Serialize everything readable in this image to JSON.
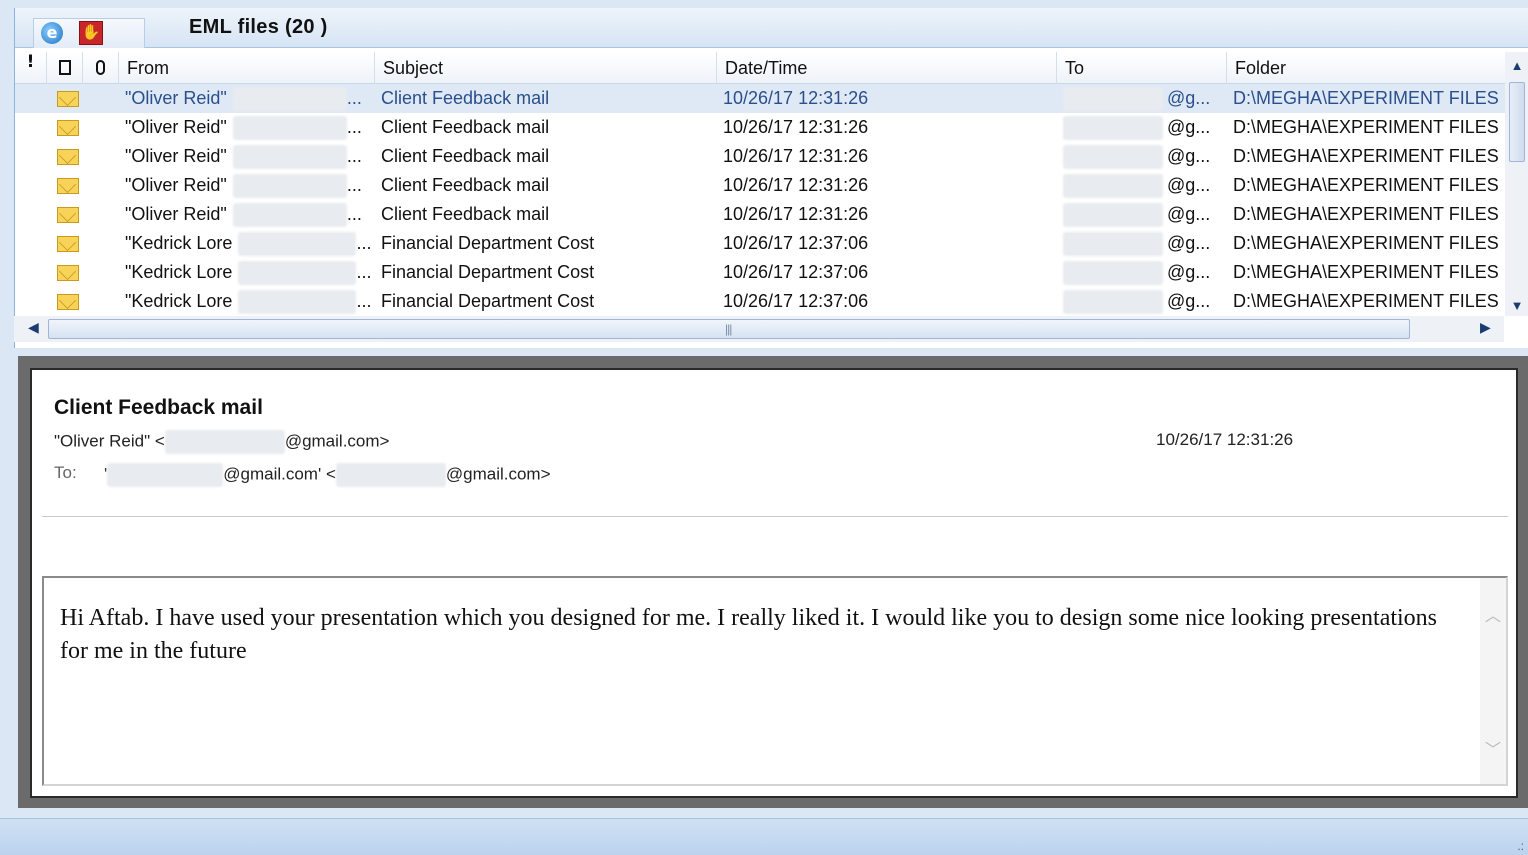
{
  "window": {
    "title": "EML files (20 )",
    "toolbar_icons": [
      "internet-explorer-icon",
      "stop-hand-icon"
    ]
  },
  "grid": {
    "columns": [
      {
        "key": "flag",
        "label": "!",
        "icon": "importance-icon"
      },
      {
        "key": "type",
        "label": "🗋",
        "icon": "document-icon"
      },
      {
        "key": "attach",
        "label": "𝟎",
        "icon": "attachment-icon"
      },
      {
        "key": "from",
        "label": "From"
      },
      {
        "key": "subject",
        "label": "Subject"
      },
      {
        "key": "date",
        "label": "Date/Time"
      },
      {
        "key": "to",
        "label": "To"
      },
      {
        "key": "folder",
        "label": "Folder"
      }
    ],
    "rows": [
      {
        "from": "\"Oliver Reid\"",
        "subject": "Client Feedback mail",
        "date": "10/26/17 12:31:26",
        "to": "@g...",
        "folder": "D:\\MEGHA\\EXPERIMENT FILES",
        "selected": true
      },
      {
        "from": "\"Oliver Reid\"",
        "subject": "Client Feedback mail",
        "date": "10/26/17 12:31:26",
        "to": "@g...",
        "folder": "D:\\MEGHA\\EXPERIMENT FILES",
        "selected": false
      },
      {
        "from": "\"Oliver Reid\"",
        "subject": "Client Feedback mail",
        "date": "10/26/17 12:31:26",
        "to": "@g...",
        "folder": "D:\\MEGHA\\EXPERIMENT FILES",
        "selected": false
      },
      {
        "from": "\"Oliver Reid\"",
        "subject": "Client Feedback mail",
        "date": "10/26/17 12:31:26",
        "to": "@g...",
        "folder": "D:\\MEGHA\\EXPERIMENT FILES",
        "selected": false
      },
      {
        "from": "\"Oliver Reid\"",
        "subject": "Client Feedback mail",
        "date": "10/26/17 12:31:26",
        "to": "@g...",
        "folder": "D:\\MEGHA\\EXPERIMENT FILES",
        "selected": false
      },
      {
        "from": "\"Kedrick Lore",
        "subject": "Financial Department Cost",
        "date": "10/26/17 12:37:06",
        "to": "@g...",
        "folder": "D:\\MEGHA\\EXPERIMENT FILES",
        "selected": false
      },
      {
        "from": "\"Kedrick Lore",
        "subject": "Financial Department Cost",
        "date": "10/26/17 12:37:06",
        "to": "@g...",
        "folder": "D:\\MEGHA\\EXPERIMENT FILES",
        "selected": false
      },
      {
        "from": "\"Kedrick Lore",
        "subject": "Financial Department Cost",
        "date": "10/26/17 12:37:06",
        "to": "@g...",
        "folder": "D:\\MEGHA\\EXPERIMENT FILES",
        "selected": false
      }
    ],
    "ellipsis": "..."
  },
  "preview": {
    "subject": "Client Feedback mail",
    "from_prefix": "\"Oliver Reid\" <",
    "from_suffix": "@gmail.com>",
    "date": "10/26/17 12:31:26",
    "to_label": "To:",
    "to_part1": "'",
    "to_part2": "@gmail.com' <",
    "to_part3": "@gmail.com>",
    "body": "Hi Aftab. I have used your presentation which you designed for me. I really liked it. I would like you to design some nice looking presentations for me in the future"
  },
  "colors": {
    "selected_row_bg": "#dfe9f6",
    "selected_row_text": "#2a4f8a",
    "accent": "#1b3c70"
  }
}
